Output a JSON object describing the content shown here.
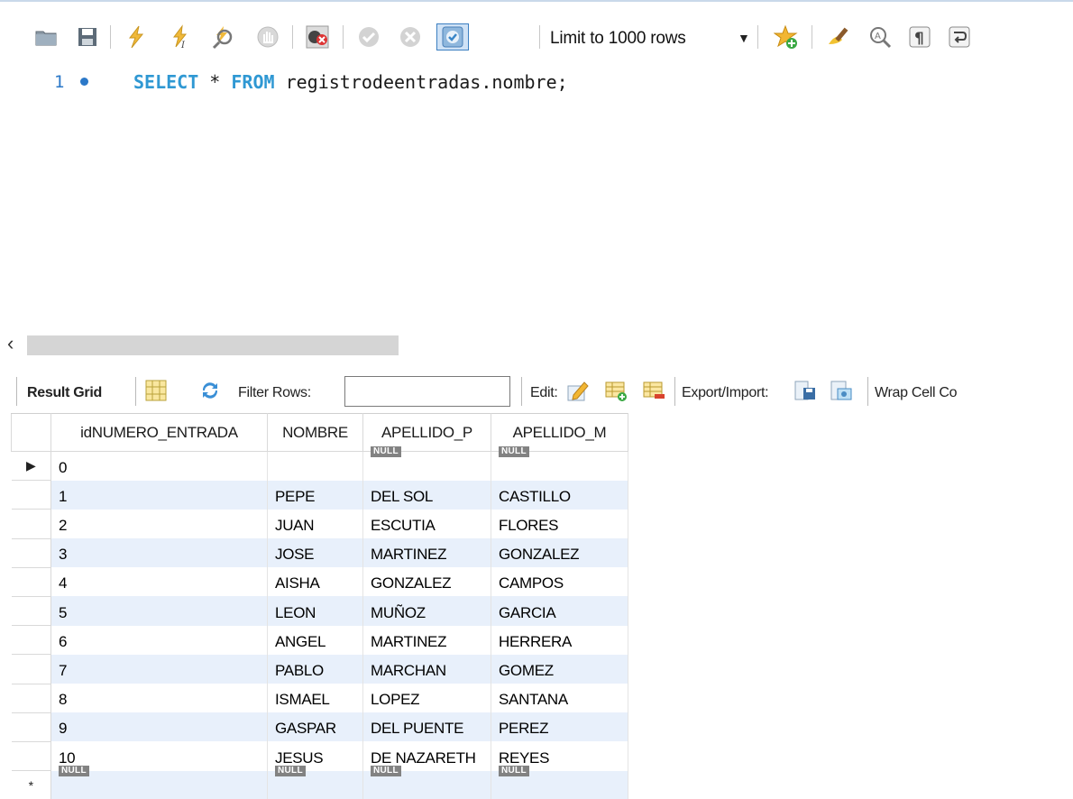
{
  "toolbar": {
    "limit_label": "Limit to 1000 rows",
    "icons": [
      "open-folder-icon",
      "save-icon",
      "execute-icon",
      "execute-current-icon",
      "explain-icon",
      "stop-icon",
      "toggle-stop-on-error-icon",
      "commit-icon",
      "rollback-icon",
      "autocommit-icon",
      "limit-dropdown-icon",
      "add-snippet-icon",
      "beautify-icon",
      "find-icon",
      "invisible-chars-icon",
      "wrap-lines-icon"
    ]
  },
  "editor": {
    "line_number": "1",
    "kw_select": "SELECT",
    "star": " * ",
    "kw_from": "FROM",
    "table": " registrodeentradas.nombre;"
  },
  "result_toolbar": {
    "result_grid": "Result Grid",
    "filter_rows": "Filter Rows:",
    "filter_value": "",
    "edit": "Edit:",
    "export_import": "Export/Import:",
    "wrap_cell": "Wrap Cell Co"
  },
  "grid": {
    "columns": [
      "idNUMERO_ENTRADA",
      "NOMBRE",
      "APELLIDO_P",
      "APELLIDO_M"
    ],
    "null_label": "NULL",
    "row_selected_marker": "▶",
    "new_row_marker": "*",
    "rows": [
      [
        "0",
        "",
        "NULL",
        "NULL"
      ],
      [
        "1",
        "PEPE",
        "DEL SOL",
        "CASTILLO"
      ],
      [
        "2",
        "JUAN",
        "ESCUTIA",
        "FLORES"
      ],
      [
        "3",
        "JOSE",
        "MARTINEZ",
        "GONZALEZ"
      ],
      [
        "4",
        "AISHA",
        "GONZALEZ",
        "CAMPOS"
      ],
      [
        "5",
        "LEON",
        "MUÑOZ",
        "GARCIA"
      ],
      [
        "6",
        "ANGEL",
        "MARTINEZ",
        "HERRERA"
      ],
      [
        "7",
        "PABLO",
        "MARCHAN",
        "GOMEZ"
      ],
      [
        "8",
        "ISMAEL",
        "LOPEZ",
        "SANTANA"
      ],
      [
        "9",
        "GASPAR",
        "DEL PUENTE",
        "PEREZ"
      ],
      [
        "10",
        "JESUS",
        "DE NAZARETH",
        "REYES"
      ],
      [
        "NULL",
        "NULL",
        "NULL",
        "NULL"
      ]
    ]
  },
  "colors": {
    "keyword": "#2f98d3",
    "line_number": "#2b78c8",
    "row_alt": "#e8f0fb",
    "null_badge": "#828282"
  }
}
